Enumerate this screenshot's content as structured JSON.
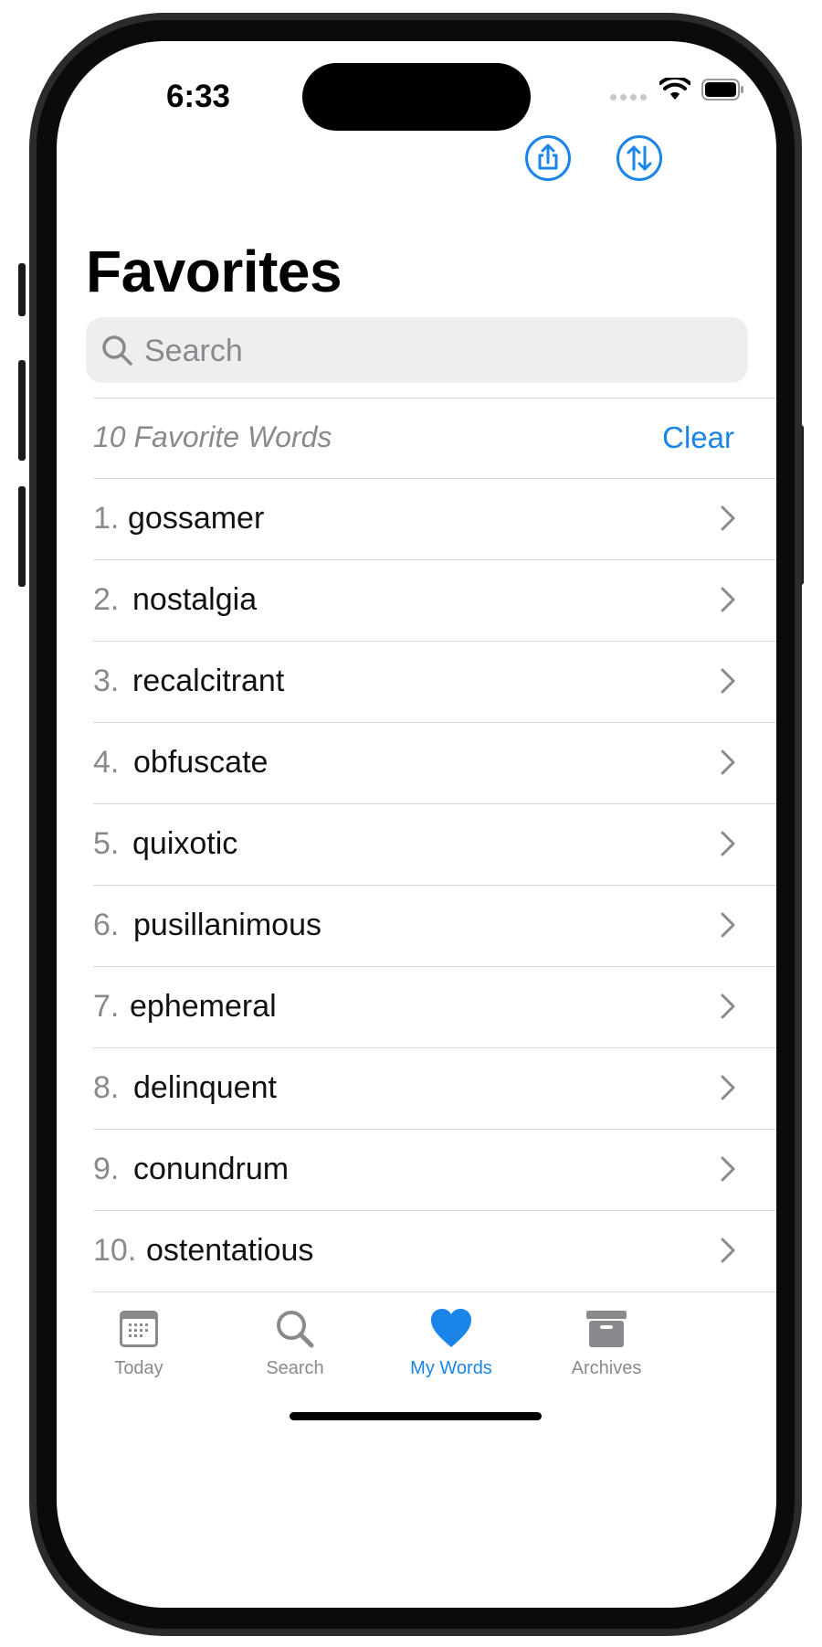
{
  "status_bar": {
    "time": "6:33"
  },
  "header": {
    "title": "Favorites",
    "share_icon": "share-icon",
    "sort_icon": "sort-arrows-icon"
  },
  "search": {
    "placeholder": "Search",
    "value": ""
  },
  "favorites": {
    "count_label": "10 Favorite Words",
    "clear_label": "Clear",
    "items": [
      {
        "num": "1.",
        "word": "gossamer"
      },
      {
        "num": "2.",
        "word": "nostalgia"
      },
      {
        "num": "3.",
        "word": "recalcitrant"
      },
      {
        "num": "4.",
        "word": "obfuscate"
      },
      {
        "num": "5.",
        "word": "quixotic"
      },
      {
        "num": "6.",
        "word": "pusillanimous"
      },
      {
        "num": "7.",
        "word": "ephemeral"
      },
      {
        "num": "8.",
        "word": "delinquent"
      },
      {
        "num": "9.",
        "word": "conundrum"
      },
      {
        "num": "10.",
        "word": "ostentatious"
      }
    ]
  },
  "tab_bar": {
    "tabs": [
      {
        "label": "Today",
        "icon": "calendar-icon",
        "active": false
      },
      {
        "label": "Search",
        "icon": "magnifier-icon",
        "active": false
      },
      {
        "label": "My Words",
        "icon": "heart-icon",
        "active": true
      },
      {
        "label": "Archives",
        "icon": "archive-box-icon",
        "active": false
      }
    ]
  },
  "colors": {
    "accent": "#1a84e8",
    "secondary_text": "#8a8a8e",
    "separator": "#d8d8da"
  }
}
